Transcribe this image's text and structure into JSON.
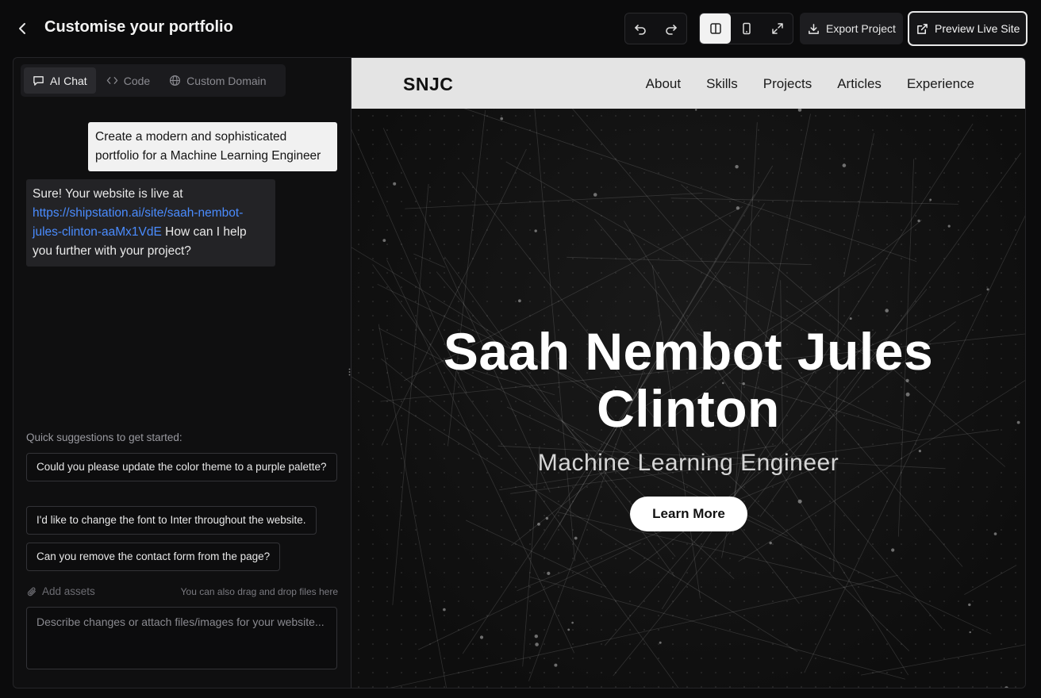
{
  "header": {
    "title": "Customise your portfolio",
    "export_label": "Export Project",
    "preview_label": "Preview Live Site"
  },
  "tabs": [
    {
      "label": "AI Chat",
      "icon": "chat-icon"
    },
    {
      "label": "Code",
      "icon": "code-icon"
    },
    {
      "label": "Custom Domain",
      "icon": "globe-icon"
    }
  ],
  "chat": {
    "user_message": "Create a modern and sophisticated portfolio for a Machine Learning Engineer",
    "bot_prefix": "Sure! Your website is live at ",
    "bot_link": "https://shipstation.ai/site/saah-nembot-jules-clinton-aaMx1VdE",
    "bot_suffix": " How can I help you further with your project?"
  },
  "suggestions": {
    "title": "Quick suggestions to get started:",
    "items": [
      "Could you please update the color theme to a purple palette?",
      "I'd like to change the font to Inter throughout the website.",
      "Can you remove the contact form from the page?"
    ]
  },
  "composer": {
    "add_assets": "Add assets",
    "drag_hint": "You can also drag and drop files here",
    "placeholder": "Describe changes or attach files/images for your website..."
  },
  "site": {
    "logo": "SNJC",
    "nav": [
      "About",
      "Skills",
      "Projects",
      "Articles",
      "Experience"
    ],
    "hero_name_line1": "Saah Nembot Jules",
    "hero_name_line2": "Clinton",
    "hero_subtitle": "Machine Learning Engineer",
    "cta": "Learn More"
  },
  "colors": {
    "link": "#4a8cff",
    "background": "#0b0b0c",
    "nav_bg": "#e4e4e4"
  }
}
